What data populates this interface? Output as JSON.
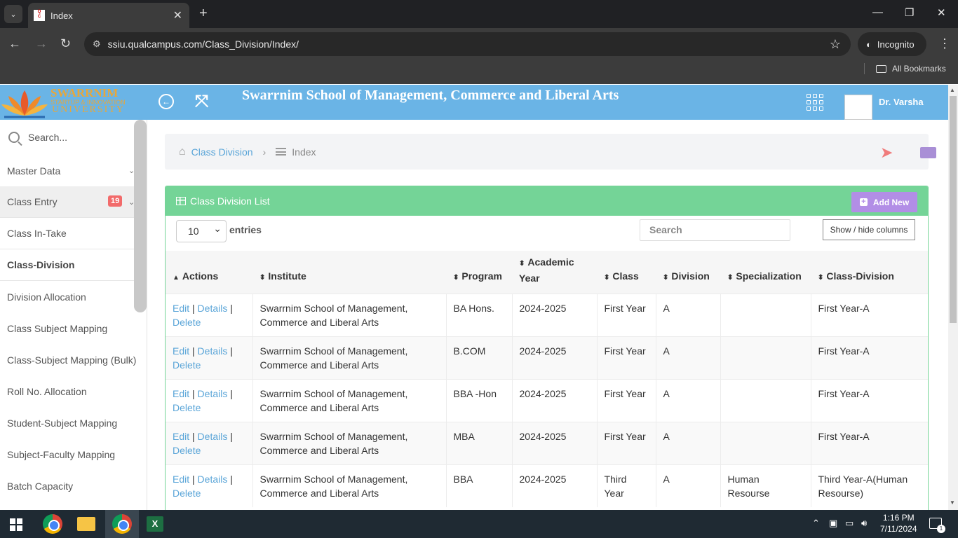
{
  "browser": {
    "tab_title": "Index",
    "url": "ssiu.qualcampus.com/Class_Division/Index/",
    "incognito_label": "Incognito",
    "bookmarks_label": "All Bookmarks"
  },
  "header": {
    "logo_name": "SWARRNIM",
    "logo_sub": "STARTUP & INNOVATION",
    "logo_uni": "UNIVERSITY",
    "title": "Swarrnim School of Management, Commerce and Liberal Arts",
    "user_name": "Dr. Varsha"
  },
  "sidebar": {
    "search_placeholder": "Search...",
    "items": [
      {
        "label": "Master Data"
      },
      {
        "label": "Class Entry",
        "badge": "19"
      },
      {
        "label": "Class In-Take"
      },
      {
        "label": "Class-Division"
      },
      {
        "label": "Division Allocation"
      },
      {
        "label": "Class Subject Mapping"
      },
      {
        "label": "Class-Subject Mapping (Bulk)"
      },
      {
        "label": "Roll No. Allocation"
      },
      {
        "label": "Student-Subject Mapping"
      },
      {
        "label": "Subject-Faculty Mapping"
      },
      {
        "label": "Batch Capacity"
      }
    ]
  },
  "breadcrumb": {
    "parent": "Class Division",
    "current": "Index"
  },
  "panel": {
    "title": "Class Division List",
    "add_label": "Add New",
    "length_value": "10",
    "entries_label": "entries",
    "search_placeholder": "Search",
    "colvis_label": "Show / hide columns"
  },
  "table": {
    "headers": [
      "Actions",
      "Institute",
      "Program",
      "Academic Year",
      "Class",
      "Division",
      "Specialization",
      "Class-Division"
    ],
    "action_edit": "Edit",
    "action_details": "Details",
    "action_delete": "Delete",
    "action_sep": "|",
    "rows": [
      {
        "institute": "Swarrnim School of Management, Commerce and Liberal Arts",
        "program": "BA Hons.",
        "year": "2024-2025",
        "class": "First Year",
        "division": "A",
        "specialization": "",
        "class_division": "First Year-A"
      },
      {
        "institute": "Swarrnim School of Management, Commerce and Liberal Arts",
        "program": "B.COM",
        "year": "2024-2025",
        "class": "First Year",
        "division": "A",
        "specialization": "",
        "class_division": "First Year-A"
      },
      {
        "institute": "Swarrnim School of Management, Commerce and Liberal Arts",
        "program": "BBA -Hon",
        "year": "2024-2025",
        "class": "First Year",
        "division": "A",
        "specialization": "",
        "class_division": "First Year-A"
      },
      {
        "institute": "Swarrnim School of Management, Commerce and Liberal Arts",
        "program": "MBA",
        "year": "2024-2025",
        "class": "First Year",
        "division": "A",
        "specialization": "",
        "class_division": "First Year-A"
      },
      {
        "institute": "Swarrnim School of Management, Commerce and Liberal Arts",
        "program": "BBA",
        "year": "2024-2025",
        "class": "Third Year",
        "division": "A",
        "specialization": "Human Resourse",
        "class_division": "Third Year-A(Human Resourse)"
      }
    ]
  },
  "taskbar": {
    "time": "1:16 PM",
    "date": "7/11/2024"
  },
  "colors": {
    "header_bg": "#6ab4e6",
    "panel_green": "#74d497",
    "add_purple": "#b28ee6",
    "link_blue": "#5aa5d8",
    "badge_red": "#f26b6b"
  }
}
